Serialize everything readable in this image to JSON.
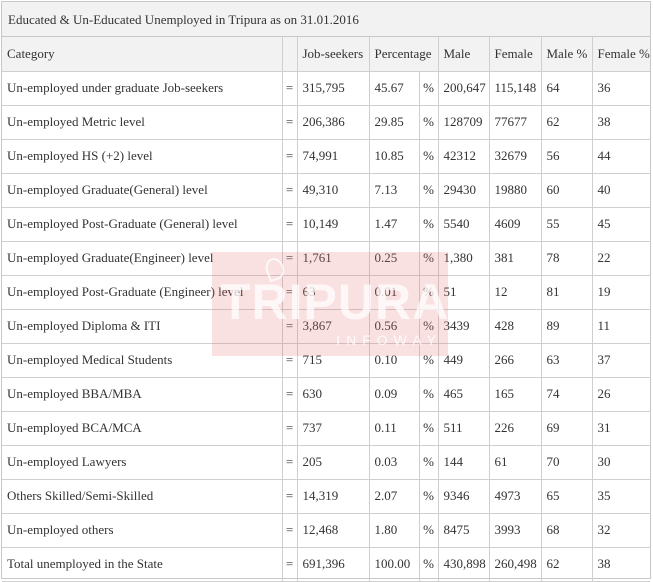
{
  "title": "Educated & Un-Educated Unemployed in Tripura as on 31.01.2016",
  "headers": {
    "category": "Category",
    "job_seekers": "Job-seekers",
    "percentage": "Percentage",
    "male": "Male",
    "female": "Female",
    "male_pct": "Male %",
    "female_pct": "Female %"
  },
  "eq_symbol": "=",
  "pct_symbol": "%",
  "rows": [
    {
      "category": "Un-employed under graduate Job-seekers",
      "job_seekers": "315,795",
      "percentage": "45.67",
      "male": "200,647",
      "female": "115,148",
      "male_pct": "64",
      "female_pct": "36"
    },
    {
      "category": "Un-employed  Metric level",
      "job_seekers": "206,386",
      "percentage": "29.85",
      "male": "128709",
      "female": "77677",
      "male_pct": "62",
      "female_pct": "38"
    },
    {
      "category": "Un-employed HS (+2) level",
      "job_seekers": "74,991",
      "percentage": "10.85",
      "male": "42312",
      "female": "32679",
      "male_pct": "56",
      "female_pct": "44"
    },
    {
      "category": "Un-employed Graduate(General)  level",
      "job_seekers": "49,310",
      "percentage": "7.13",
      "male": "29430",
      "female": "19880",
      "male_pct": "60",
      "female_pct": "40"
    },
    {
      "category": "Un-employed Post-Graduate (General) level",
      "job_seekers": "10,149",
      "percentage": "1.47",
      "male": "5540",
      "female": "4609",
      "male_pct": "55",
      "female_pct": "45"
    },
    {
      "category": "Un-employed Graduate(Engineer)  level",
      "job_seekers": "1,761",
      "percentage": "0.25",
      "male": "1,380",
      "female": "381",
      "male_pct": "78",
      "female_pct": "22"
    },
    {
      "category": "Un-employed Post-Graduate (Engineer) level",
      "job_seekers": "63",
      "percentage": "0.01",
      "male": "51",
      "female": "12",
      "male_pct": "81",
      "female_pct": "19"
    },
    {
      "category": "Un-employed Diploma & ITI",
      "job_seekers": "3,867",
      "percentage": "0.56",
      "male": "3439",
      "female": "428",
      "male_pct": "89",
      "female_pct": "11"
    },
    {
      "category": "Un-employed Medical Students",
      "job_seekers": "715",
      "percentage": "0.10",
      "male": "449",
      "female": "266",
      "male_pct": "63",
      "female_pct": "37"
    },
    {
      "category": "Un-employed BBA/MBA",
      "job_seekers": "630",
      "percentage": "0.09",
      "male": "465",
      "female": "165",
      "male_pct": "74",
      "female_pct": "26"
    },
    {
      "category": "Un-employed BCA/MCA",
      "job_seekers": "737",
      "percentage": "0.11",
      "male": "511",
      "female": "226",
      "male_pct": "69",
      "female_pct": "31"
    },
    {
      "category": "Un-employed Lawyers",
      "job_seekers": "205",
      "percentage": "0.03",
      "male": "144",
      "female": "61",
      "male_pct": "70",
      "female_pct": "30"
    },
    {
      "category": "Others Skilled/Semi-Skilled",
      "job_seekers": "14,319",
      "percentage": "2.07",
      "male": "9346",
      "female": "4973",
      "male_pct": "65",
      "female_pct": "35"
    },
    {
      "category": "Un-employed others",
      "job_seekers": "12,468",
      "percentage": "1.80",
      "male": "8475",
      "female": "3993",
      "male_pct": "68",
      "female_pct": "32"
    },
    {
      "category": "Total unemployed in the State",
      "job_seekers": "691,396",
      "percentage": "100.00",
      "male": "430,898",
      "female": "260,498",
      "male_pct": "62",
      "female_pct": "38"
    }
  ],
  "watermark": {
    "text": "TRIPURA",
    "subtext": "INFOWAY"
  }
}
